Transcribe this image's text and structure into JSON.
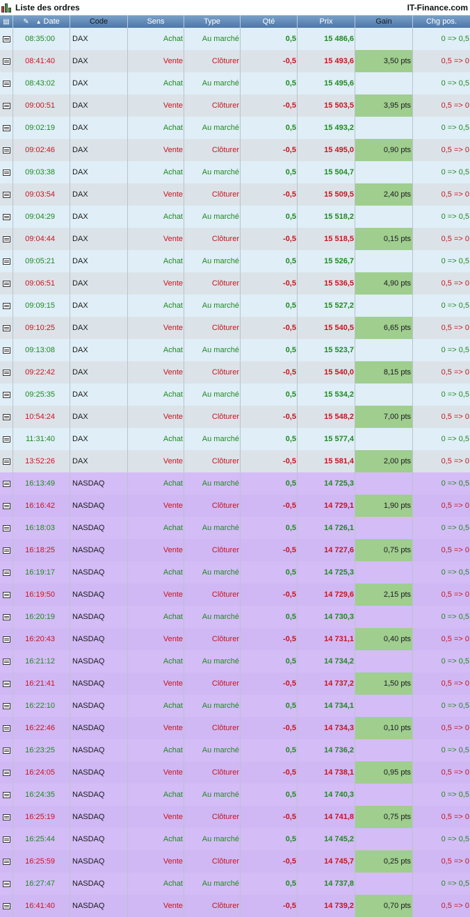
{
  "window": {
    "title": "Liste des ordres",
    "brand": "IT-Finance.com"
  },
  "header": {
    "date": "Date",
    "code": "Code",
    "sens": "Sens",
    "type": "Type",
    "qte": "Qté",
    "prix": "Prix",
    "gain": "Gain",
    "chg": "Chg pos."
  },
  "colors": {
    "buy": "#1f8a1f",
    "sell": "#c8141e",
    "gain_bg": "#9fce8f",
    "dax_bg": "#dfeef7",
    "nasdaq_bg": "#d4bcf7"
  },
  "rows": [
    {
      "date": "08:35:00",
      "code": "DAX",
      "sens": "Achat",
      "type": "Au marché",
      "qte": "0,5",
      "prix": "15 486,6",
      "gain": "",
      "chg": "0 => 0,5"
    },
    {
      "date": "08:41:40",
      "code": "DAX",
      "sens": "Vente",
      "type": "Clôturer",
      "qte": "-0,5",
      "prix": "15 493,6",
      "gain": "3,50 pts",
      "chg": "0,5 => 0"
    },
    {
      "date": "08:43:02",
      "code": "DAX",
      "sens": "Achat",
      "type": "Au marché",
      "qte": "0,5",
      "prix": "15 495,6",
      "gain": "",
      "chg": "0 => 0,5"
    },
    {
      "date": "09:00:51",
      "code": "DAX",
      "sens": "Vente",
      "type": "Clôturer",
      "qte": "-0,5",
      "prix": "15 503,5",
      "gain": "3,95 pts",
      "chg": "0,5 => 0"
    },
    {
      "date": "09:02:19",
      "code": "DAX",
      "sens": "Achat",
      "type": "Au marché",
      "qte": "0,5",
      "prix": "15 493,2",
      "gain": "",
      "chg": "0 => 0,5"
    },
    {
      "date": "09:02:46",
      "code": "DAX",
      "sens": "Vente",
      "type": "Clôturer",
      "qte": "-0,5",
      "prix": "15 495,0",
      "gain": "0,90 pts",
      "chg": "0,5 => 0"
    },
    {
      "date": "09:03:38",
      "code": "DAX",
      "sens": "Achat",
      "type": "Au marché",
      "qte": "0,5",
      "prix": "15 504,7",
      "gain": "",
      "chg": "0 => 0,5"
    },
    {
      "date": "09:03:54",
      "code": "DAX",
      "sens": "Vente",
      "type": "Clôturer",
      "qte": "-0,5",
      "prix": "15 509,5",
      "gain": "2,40 pts",
      "chg": "0,5 => 0"
    },
    {
      "date": "09:04:29",
      "code": "DAX",
      "sens": "Achat",
      "type": "Au marché",
      "qte": "0,5",
      "prix": "15 518,2",
      "gain": "",
      "chg": "0 => 0,5"
    },
    {
      "date": "09:04:44",
      "code": "DAX",
      "sens": "Vente",
      "type": "Clôturer",
      "qte": "-0,5",
      "prix": "15 518,5",
      "gain": "0,15 pts",
      "chg": "0,5 => 0"
    },
    {
      "date": "09:05:21",
      "code": "DAX",
      "sens": "Achat",
      "type": "Au marché",
      "qte": "0,5",
      "prix": "15 526,7",
      "gain": "",
      "chg": "0 => 0,5"
    },
    {
      "date": "09:06:51",
      "code": "DAX",
      "sens": "Vente",
      "type": "Clôturer",
      "qte": "-0,5",
      "prix": "15 536,5",
      "gain": "4,90 pts",
      "chg": "0,5 => 0"
    },
    {
      "date": "09:09:15",
      "code": "DAX",
      "sens": "Achat",
      "type": "Au marché",
      "qte": "0,5",
      "prix": "15 527,2",
      "gain": "",
      "chg": "0 => 0,5"
    },
    {
      "date": "09:10:25",
      "code": "DAX",
      "sens": "Vente",
      "type": "Clôturer",
      "qte": "-0,5",
      "prix": "15 540,5",
      "gain": "6,65 pts",
      "chg": "0,5 => 0"
    },
    {
      "date": "09:13:08",
      "code": "DAX",
      "sens": "Achat",
      "type": "Au marché",
      "qte": "0,5",
      "prix": "15 523,7",
      "gain": "",
      "chg": "0 => 0,5"
    },
    {
      "date": "09:22:42",
      "code": "DAX",
      "sens": "Vente",
      "type": "Clôturer",
      "qte": "-0,5",
      "prix": "15 540,0",
      "gain": "8,15 pts",
      "chg": "0,5 => 0"
    },
    {
      "date": "09:25:35",
      "code": "DAX",
      "sens": "Achat",
      "type": "Au marché",
      "qte": "0,5",
      "prix": "15 534,2",
      "gain": "",
      "chg": "0 => 0,5"
    },
    {
      "date": "10:54:24",
      "code": "DAX",
      "sens": "Vente",
      "type": "Clôturer",
      "qte": "-0,5",
      "prix": "15 548,2",
      "gain": "7,00 pts",
      "chg": "0,5 => 0"
    },
    {
      "date": "11:31:40",
      "code": "DAX",
      "sens": "Achat",
      "type": "Au marché",
      "qte": "0,5",
      "prix": "15 577,4",
      "gain": "",
      "chg": "0 => 0,5"
    },
    {
      "date": "13:52:26",
      "code": "DAX",
      "sens": "Vente",
      "type": "Clôturer",
      "qte": "-0,5",
      "prix": "15 581,4",
      "gain": "2,00 pts",
      "chg": "0,5 => 0"
    },
    {
      "date": "16:13:49",
      "code": "NASDAQ",
      "sens": "Achat",
      "type": "Au marché",
      "qte": "0,5",
      "prix": "14 725,3",
      "gain": "",
      "chg": "0 => 0,5"
    },
    {
      "date": "16:16:42",
      "code": "NASDAQ",
      "sens": "Vente",
      "type": "Clôturer",
      "qte": "-0,5",
      "prix": "14 729,1",
      "gain": "1,90 pts",
      "chg": "0,5 => 0"
    },
    {
      "date": "16:18:03",
      "code": "NASDAQ",
      "sens": "Achat",
      "type": "Au marché",
      "qte": "0,5",
      "prix": "14 726,1",
      "gain": "",
      "chg": "0 => 0,5"
    },
    {
      "date": "16:18:25",
      "code": "NASDAQ",
      "sens": "Vente",
      "type": "Clôturer",
      "qte": "-0,5",
      "prix": "14 727,6",
      "gain": "0,75 pts",
      "chg": "0,5 => 0"
    },
    {
      "date": "16:19:17",
      "code": "NASDAQ",
      "sens": "Achat",
      "type": "Au marché",
      "qte": "0,5",
      "prix": "14 725,3",
      "gain": "",
      "chg": "0 => 0,5"
    },
    {
      "date": "16:19:50",
      "code": "NASDAQ",
      "sens": "Vente",
      "type": "Clôturer",
      "qte": "-0,5",
      "prix": "14 729,6",
      "gain": "2,15 pts",
      "chg": "0,5 => 0"
    },
    {
      "date": "16:20:19",
      "code": "NASDAQ",
      "sens": "Achat",
      "type": "Au marché",
      "qte": "0,5",
      "prix": "14 730,3",
      "gain": "",
      "chg": "0 => 0,5"
    },
    {
      "date": "16:20:43",
      "code": "NASDAQ",
      "sens": "Vente",
      "type": "Clôturer",
      "qte": "-0,5",
      "prix": "14 731,1",
      "gain": "0,40 pts",
      "chg": "0,5 => 0"
    },
    {
      "date": "16:21:12",
      "code": "NASDAQ",
      "sens": "Achat",
      "type": "Au marché",
      "qte": "0,5",
      "prix": "14 734,2",
      "gain": "",
      "chg": "0 => 0,5"
    },
    {
      "date": "16:21:41",
      "code": "NASDAQ",
      "sens": "Vente",
      "type": "Clôturer",
      "qte": "-0,5",
      "prix": "14 737,2",
      "gain": "1,50 pts",
      "chg": "0,5 => 0"
    },
    {
      "date": "16:22:10",
      "code": "NASDAQ",
      "sens": "Achat",
      "type": "Au marché",
      "qte": "0,5",
      "prix": "14 734,1",
      "gain": "",
      "chg": "0 => 0,5"
    },
    {
      "date": "16:22:46",
      "code": "NASDAQ",
      "sens": "Vente",
      "type": "Clôturer",
      "qte": "-0,5",
      "prix": "14 734,3",
      "gain": "0,10 pts",
      "chg": "0,5 => 0"
    },
    {
      "date": "16:23:25",
      "code": "NASDAQ",
      "sens": "Achat",
      "type": "Au marché",
      "qte": "0,5",
      "prix": "14 736,2",
      "gain": "",
      "chg": "0 => 0,5"
    },
    {
      "date": "16:24:05",
      "code": "NASDAQ",
      "sens": "Vente",
      "type": "Clôturer",
      "qte": "-0,5",
      "prix": "14 738,1",
      "gain": "0,95 pts",
      "chg": "0,5 => 0"
    },
    {
      "date": "16:24:35",
      "code": "NASDAQ",
      "sens": "Achat",
      "type": "Au marché",
      "qte": "0,5",
      "prix": "14 740,3",
      "gain": "",
      "chg": "0 => 0,5"
    },
    {
      "date": "16:25:19",
      "code": "NASDAQ",
      "sens": "Vente",
      "type": "Clôturer",
      "qte": "-0,5",
      "prix": "14 741,8",
      "gain": "0,75 pts",
      "chg": "0,5 => 0"
    },
    {
      "date": "16:25:44",
      "code": "NASDAQ",
      "sens": "Achat",
      "type": "Au marché",
      "qte": "0,5",
      "prix": "14 745,2",
      "gain": "",
      "chg": "0 => 0,5"
    },
    {
      "date": "16:25:59",
      "code": "NASDAQ",
      "sens": "Vente",
      "type": "Clôturer",
      "qte": "-0,5",
      "prix": "14 745,7",
      "gain": "0,25 pts",
      "chg": "0,5 => 0"
    },
    {
      "date": "16:27:47",
      "code": "NASDAQ",
      "sens": "Achat",
      "type": "Au marché",
      "qte": "0,5",
      "prix": "14 737,8",
      "gain": "",
      "chg": "0 => 0,5"
    },
    {
      "date": "16:41:40",
      "code": "NASDAQ",
      "sens": "Vente",
      "type": "Clôturer",
      "qte": "-0,5",
      "prix": "14 739,2",
      "gain": "0,70 pts",
      "chg": "0,5 => 0"
    }
  ]
}
